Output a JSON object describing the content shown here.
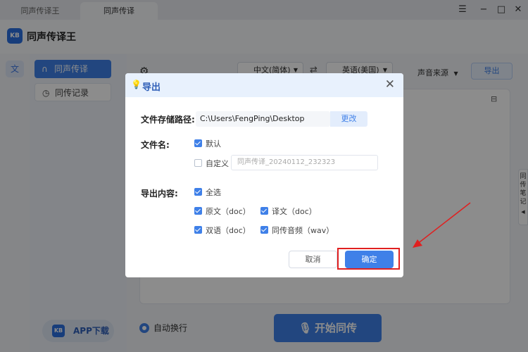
{
  "tabs": [
    "同声传译王",
    "同声传译"
  ],
  "window_controls": {
    "menu": "☰",
    "minimize": "−",
    "maximize": "□",
    "close": "✕"
  },
  "app": {
    "logo_text": "KB",
    "title": "同声传译王"
  },
  "sidebar": {
    "items": [
      {
        "label": "同声传译",
        "icon": "headphones-icon",
        "glyph": "∩"
      },
      {
        "label": "同传记录",
        "icon": "clock-icon",
        "glyph": "◷"
      }
    ],
    "app_download": "APP下载"
  },
  "toolbar": {
    "source_lang": "中文(简体)",
    "target_lang": "英语(美国)",
    "audio_source": "声音来源",
    "export": "导出"
  },
  "side_notes": "同传笔记",
  "bottom": {
    "auto_wrap": "自动换行",
    "start": "开始同传"
  },
  "dialog": {
    "title": "导出",
    "path_label": "文件存储路径:",
    "path_value": "C:\\Users\\FengPing\\Desktop",
    "change": "更改",
    "filename_label": "文件名:",
    "default_option": "默认",
    "custom_option": "自定义",
    "custom_placeholder": "同声传译_20240112_232323",
    "content_label": "导出内容:",
    "select_all": "全选",
    "options": [
      "原文（doc）",
      "译文（doc）",
      "双语（doc）",
      "同传音频（wav）"
    ],
    "cancel": "取消",
    "confirm": "确定"
  },
  "colors": {
    "accent": "#3f80e8",
    "annotation": "#e02020"
  }
}
